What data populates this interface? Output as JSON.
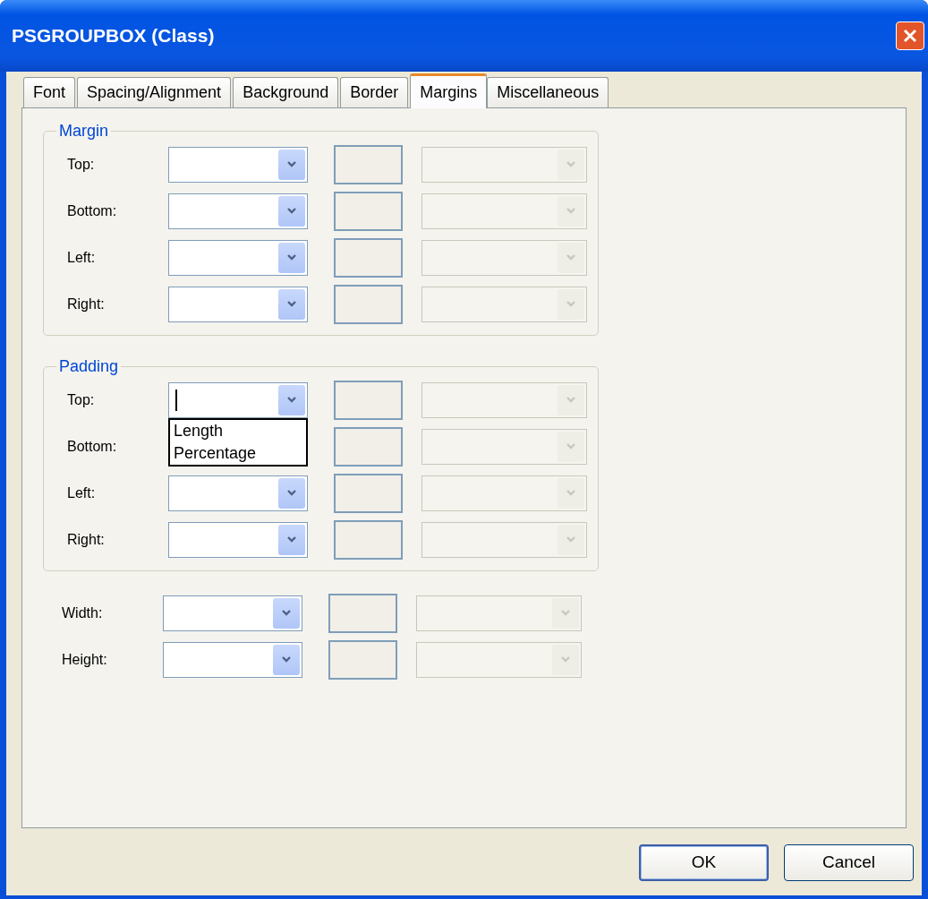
{
  "window": {
    "title": "PSGROUPBOX (Class)"
  },
  "tabs": [
    {
      "label": "Font",
      "selected": false
    },
    {
      "label": "Spacing/Alignment",
      "selected": false
    },
    {
      "label": "Background",
      "selected": false
    },
    {
      "label": "Border",
      "selected": false
    },
    {
      "label": "Margins",
      "selected": true
    },
    {
      "label": "Miscellaneous",
      "selected": false
    }
  ],
  "groups": [
    {
      "title": "Margin",
      "rows": [
        {
          "label": "Top:"
        },
        {
          "label": "Bottom:"
        },
        {
          "label": "Left:"
        },
        {
          "label": "Right:"
        }
      ]
    },
    {
      "title": "Padding",
      "rows": [
        {
          "label": "Top:",
          "options": [
            "Length",
            "Percentage"
          ]
        },
        {
          "label": "Bottom:"
        },
        {
          "label": "Left:"
        },
        {
          "label": "Right:"
        }
      ]
    }
  ],
  "size_rows": [
    {
      "label": "Width:"
    },
    {
      "label": "Height:"
    }
  ],
  "buttons": [
    {
      "label": "OK",
      "default": true
    },
    {
      "label": "Cancel",
      "default": false
    }
  ]
}
